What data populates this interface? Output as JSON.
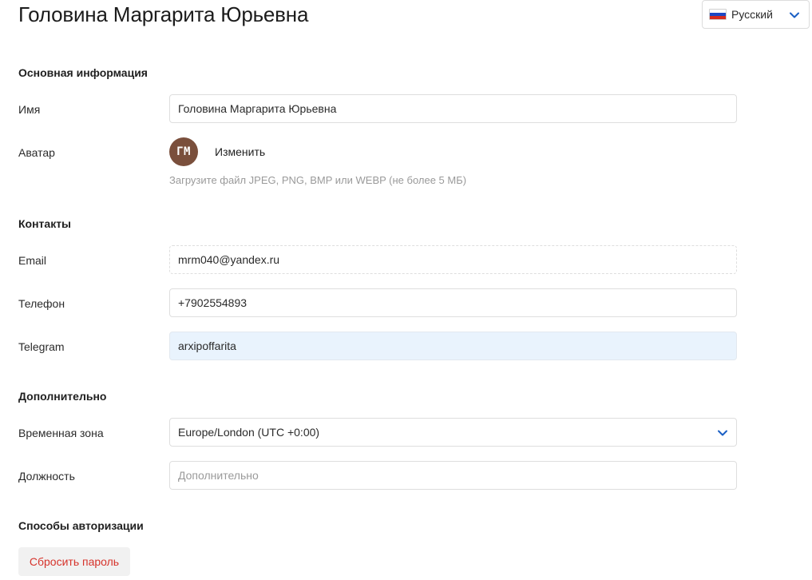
{
  "header": {
    "title": "Головина Маргарита Юрьевна",
    "language": {
      "label": "Русский",
      "flag_icon": "russia-flag-icon"
    }
  },
  "basic": {
    "section_title": "Основная информация",
    "name_label": "Имя",
    "name_value": "Головина Маргарита Юрьевна",
    "avatar_label": "Аватар",
    "avatar_initials": "ГМ",
    "avatar_color": "#7a4f3c",
    "avatar_change": "Изменить",
    "avatar_hint": "Загрузите файл JPEG, PNG, BMP или WEBP (не более 5 МБ)"
  },
  "contacts": {
    "section_title": "Контакты",
    "email_label": "Email",
    "email_value": "mrm040@yandex.ru",
    "phone_label": "Телефон",
    "phone_value": "+7902554893",
    "telegram_label": "Telegram",
    "telegram_value": "arxipoffarita"
  },
  "additional": {
    "section_title": "Дополнительно",
    "timezone_label": "Временная зона",
    "timezone_value": "Europe/London (UTC +0:00)",
    "position_label": "Должность",
    "position_placeholder": "Дополнительно"
  },
  "auth": {
    "section_title": "Способы авторизации",
    "reset_password": "Сбросить пароль",
    "reset_color": "#d6332b"
  },
  "colors": {
    "accent_chevron": "#1a5fc4",
    "focused_field_bg": "#e9f3fd"
  }
}
